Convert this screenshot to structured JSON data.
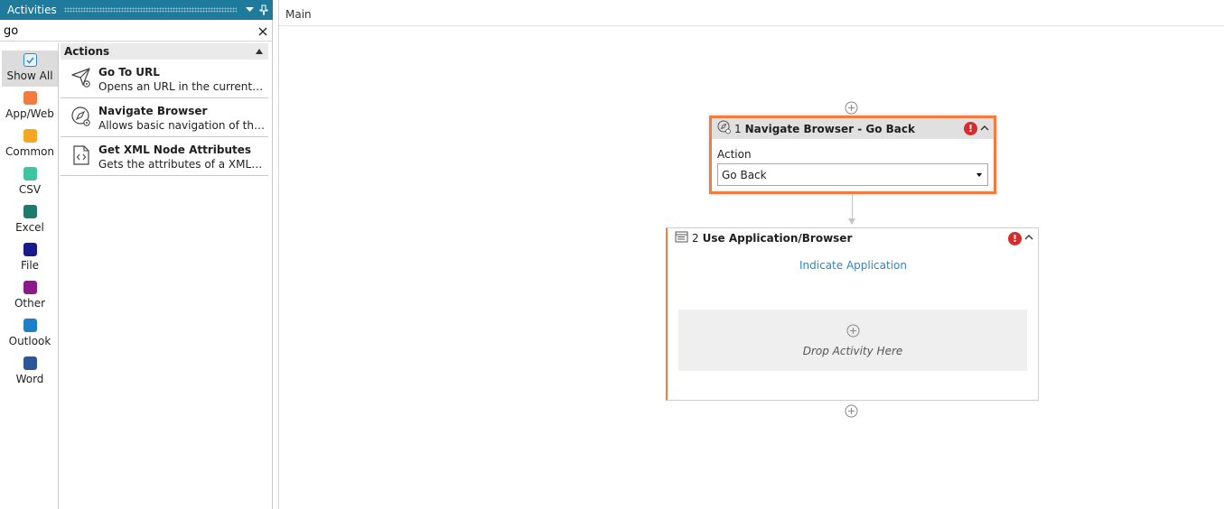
{
  "activities_panel": {
    "title": "Activities",
    "search_value": "go",
    "categories": [
      {
        "label": "Show All",
        "icon": "checkbox-icon",
        "color": "#2f86c8",
        "selected": true
      },
      {
        "label": "App/Web",
        "icon": "app-web-icon",
        "color": "#f47b3d"
      },
      {
        "label": "Common",
        "icon": "common-icon",
        "color": "#f5a623"
      },
      {
        "label": "CSV",
        "icon": "csv-icon",
        "color": "#3ec4a0"
      },
      {
        "label": "Excel",
        "icon": "excel-icon",
        "color": "#1e7a6b"
      },
      {
        "label": "File",
        "icon": "file-icon",
        "color": "#1a1a8c"
      },
      {
        "label": "Other",
        "icon": "other-icon",
        "color": "#8b1a8b"
      },
      {
        "label": "Outlook",
        "icon": "outlook-icon",
        "color": "#1d7fc8"
      },
      {
        "label": "Word",
        "icon": "word-icon",
        "color": "#2b5797"
      }
    ],
    "section_title": "Actions",
    "items": [
      {
        "title": "Go To URL",
        "description": "Opens an URL in the current browser",
        "icon": "send-icon"
      },
      {
        "title": "Navigate Browser",
        "description": "Allows basic navigation of the browser",
        "icon": "compass-icon"
      },
      {
        "title": "Get XML Node Attributes",
        "description": "Gets the attributes of a XML Node",
        "icon": "xml-file-icon"
      }
    ]
  },
  "designer": {
    "breadcrumb": "Main",
    "activities": [
      {
        "number": "1",
        "title": "Navigate Browser - Go Back",
        "field_label": "Action",
        "field_value": "Go Back",
        "status": "error"
      },
      {
        "number": "2",
        "title": "Use Application/Browser",
        "link": "Indicate Application",
        "drop_text": "Drop Activity Here",
        "status": "error"
      }
    ]
  },
  "colors": {
    "accent": "#1e7b9b",
    "selected_border": "#f47b3d",
    "error": "#d92b2b",
    "link": "#2f86c8"
  }
}
